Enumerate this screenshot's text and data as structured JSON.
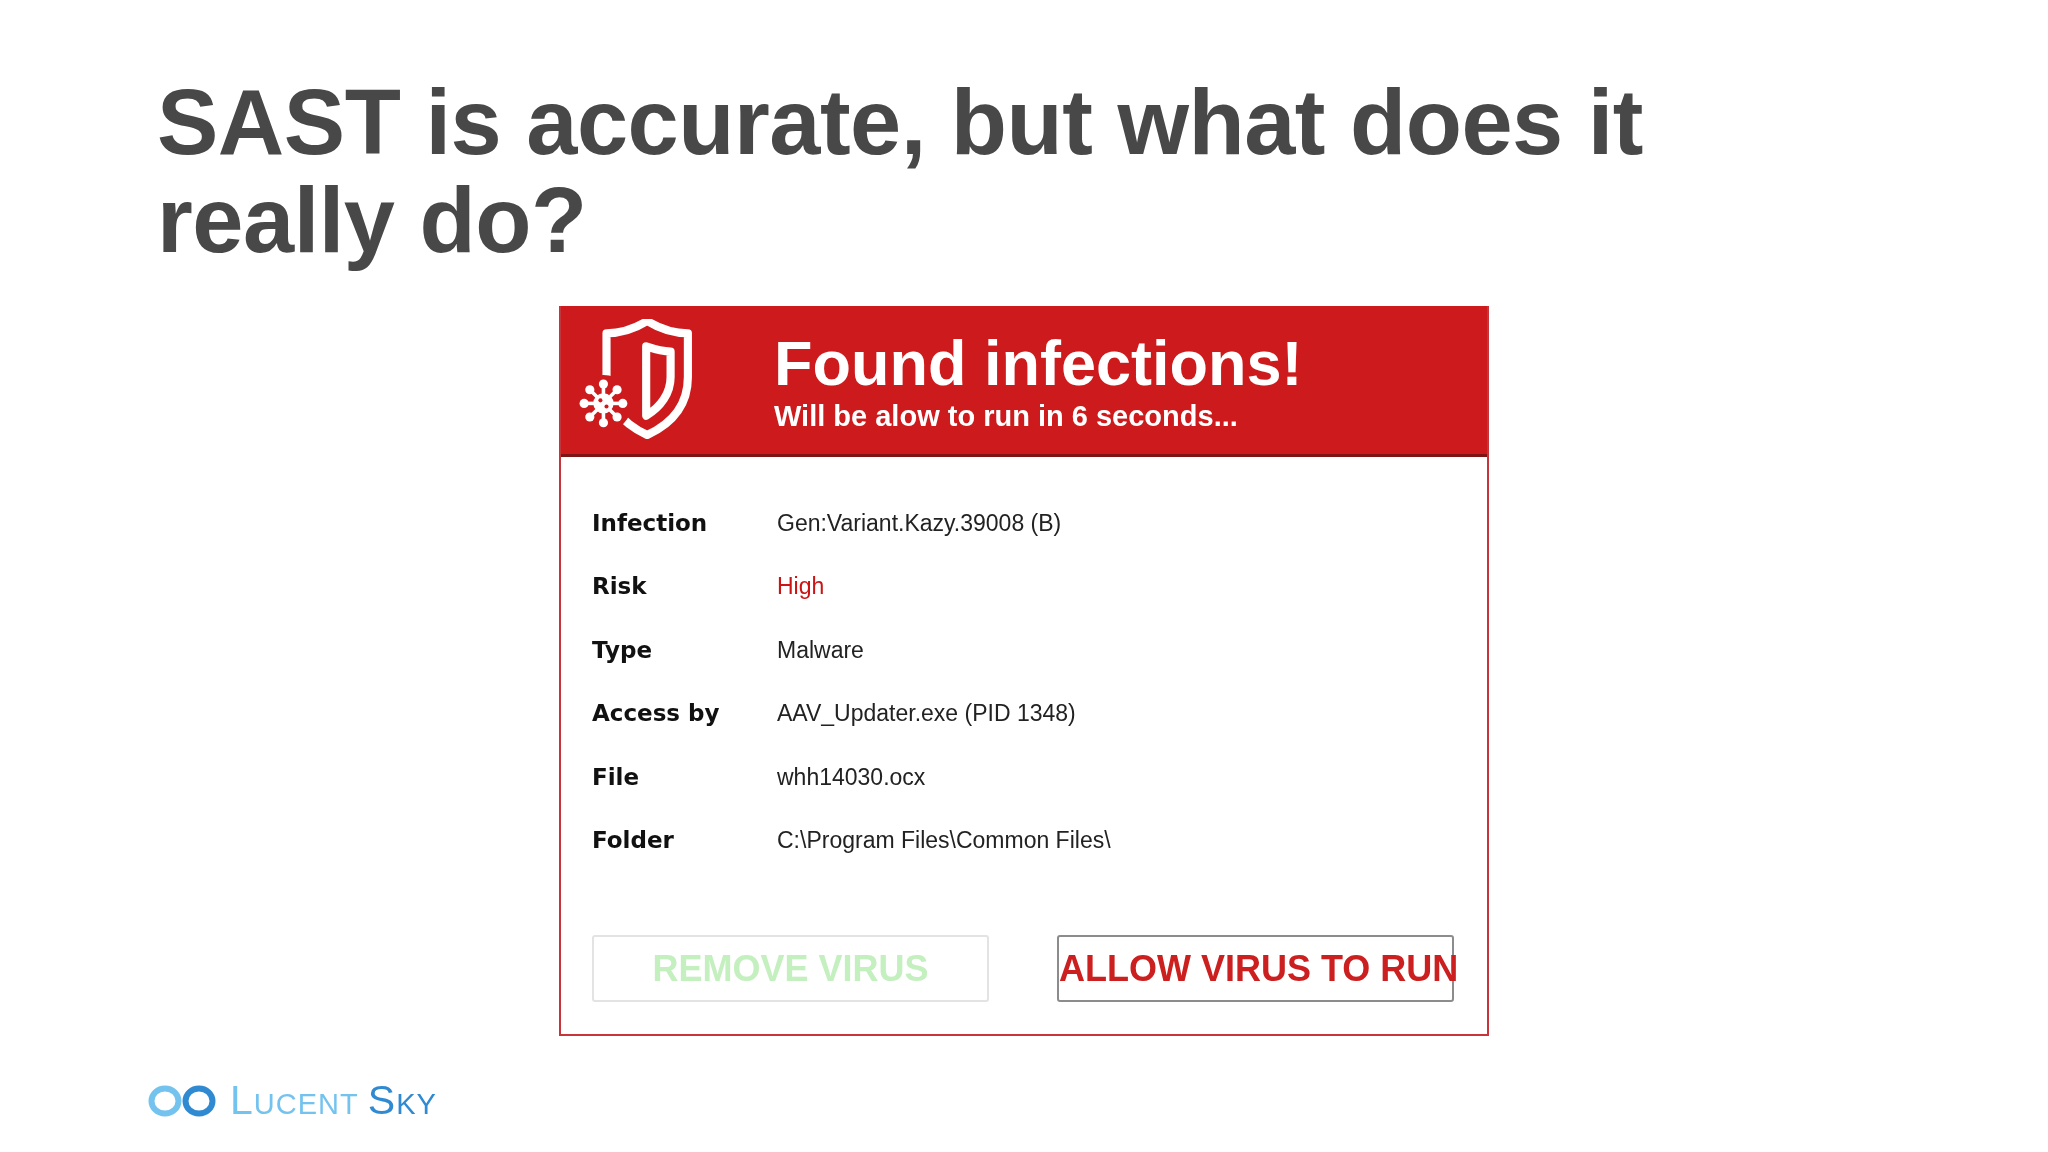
{
  "slide_title": "SAST is accurate, but what does it really do?",
  "dialog": {
    "title": "Found infections!",
    "subtitle": "Will be alow to run in 6 seconds...",
    "details": [
      {
        "label": "Infection",
        "value": "Gen:Variant.Kazy.39008 (B)",
        "color": "#222222"
      },
      {
        "label": "Risk",
        "value": "High",
        "color": "#cc1414"
      },
      {
        "label": "Type",
        "value": "Malware",
        "color": "#222222"
      },
      {
        "label": "Access by",
        "value": "AAV_Updater.exe (PID 1348)",
        "color": "#222222"
      },
      {
        "label": "File",
        "value": "whh14030.ocx",
        "color": "#222222"
      },
      {
        "label": "Folder",
        "value": "C:\\Program Files\\Common Files\\",
        "color": "#222222"
      }
    ],
    "buttons": [
      {
        "label": "REMOVE VIRUS",
        "disabled": true,
        "color": "#c4efbf"
      },
      {
        "label": "ALLOW VIRUS TO RUN",
        "disabled": false,
        "color": "#cc1f1f"
      }
    ]
  },
  "brand": {
    "words": [
      {
        "text": "LUCENT",
        "color": "#74c3ef"
      },
      {
        "text": "SKY",
        "color": "#2f8ad2"
      }
    ]
  }
}
